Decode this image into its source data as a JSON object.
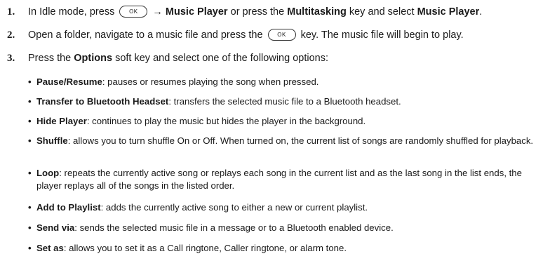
{
  "steps": [
    {
      "num": "1.",
      "t1": "In Idle mode, press",
      "key": "OK",
      "arrow": "→",
      "b1": "Music Player",
      "t2": "or press the",
      "b2": "Multitasking",
      "t3": "key and select",
      "b3": "Music Player",
      "t4": "."
    },
    {
      "num": "2.",
      "t1": "Open a folder, navigate to a music file and press the",
      "key": "OK",
      "t2": "key. The music file will begin to play."
    },
    {
      "num": "3.",
      "t1": "Press the",
      "b1": "Options",
      "t2": "soft key and select one of the following options:"
    }
  ],
  "options": [
    {
      "term": "Pause/Resume",
      "desc": ": pauses or resumes playing the song when pressed."
    },
    {
      "term": "Transfer to Bluetooth Headset",
      "desc": ": transfers the selected music file to a Bluetooth headset."
    },
    {
      "term": "Hide Player",
      "desc": ": continues to play the music but hides the player in the background."
    },
    {
      "term": "Shuffle",
      "desc": ": allows you to turn shuffle On or Off. When turned on, the current list of songs are randomly shuffled for playback."
    },
    {
      "term": "Loop",
      "desc": ": repeats the currently active song or replays each song in the current list and as the last song in the list ends, the player replays all of the songs in the listed order."
    },
    {
      "term": "Add to Playlist",
      "desc": ": adds the currently active song to either a new or current playlist."
    },
    {
      "term": "Send via",
      "desc": ": sends the selected music file in a message or to a Bluetooth enabled device."
    },
    {
      "term": "Set as",
      "desc": ": allows you to set it as a Call ringtone, Caller ringtone, or alarm tone."
    }
  ],
  "bullet_glyph": "•"
}
